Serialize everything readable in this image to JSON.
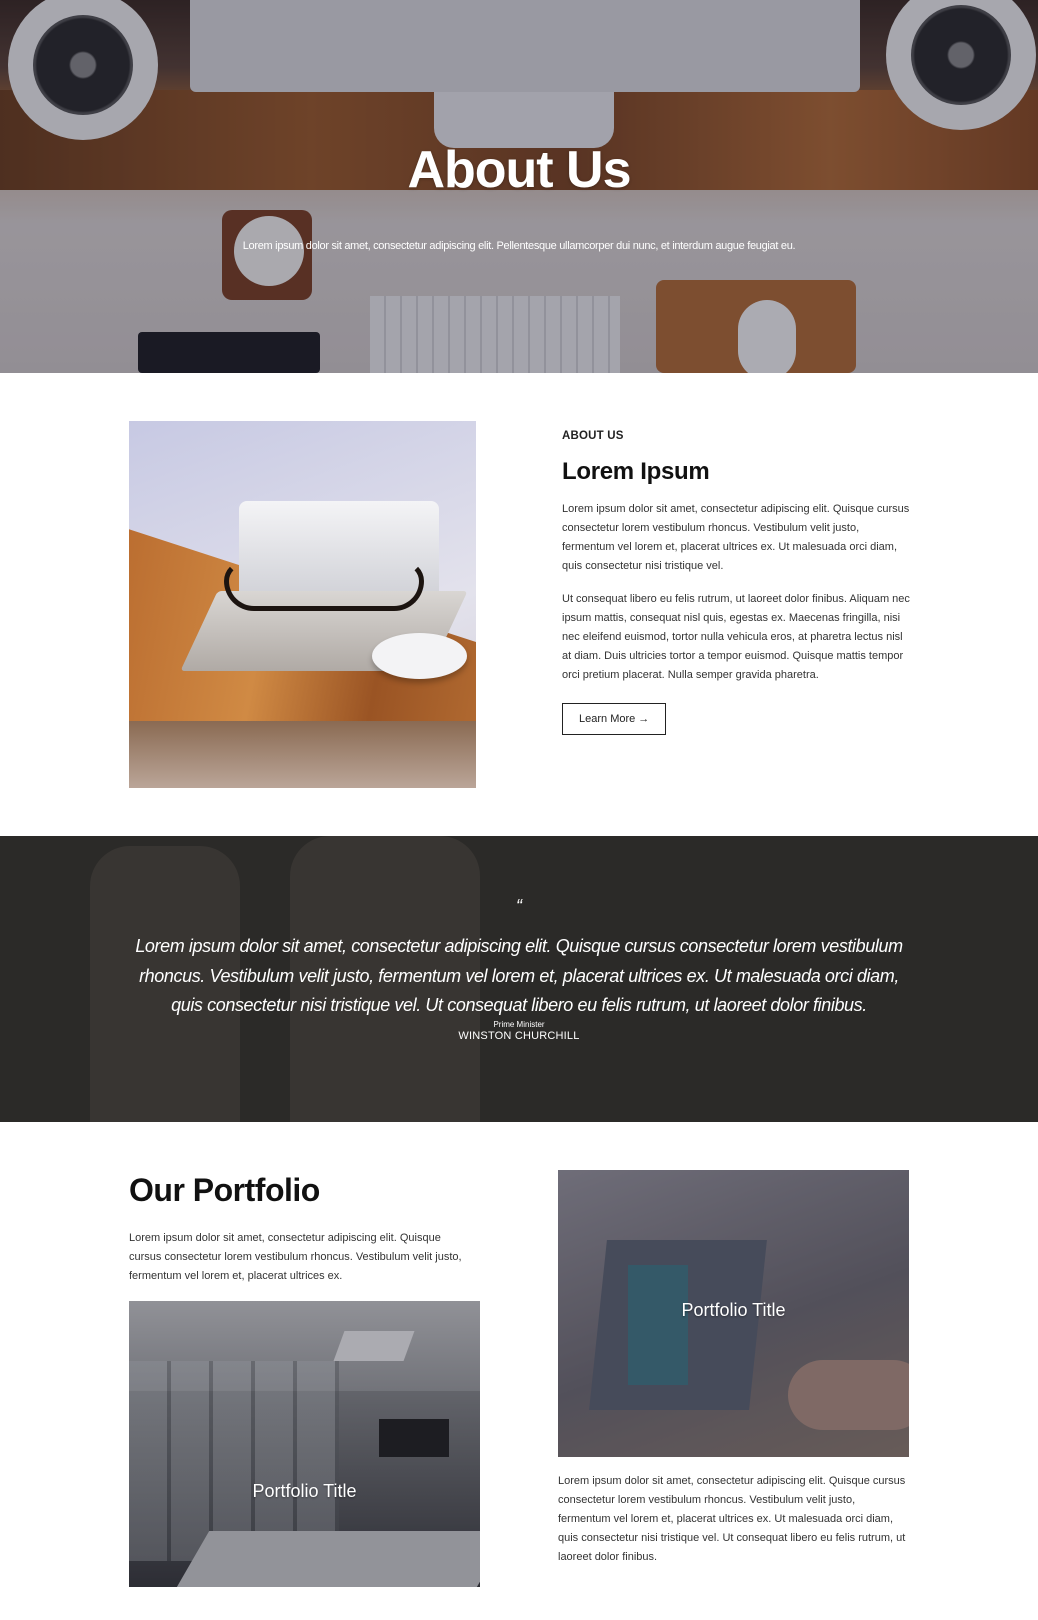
{
  "hero": {
    "title": "About Us",
    "subtitle": "Lorem ipsum dolor sit amet, consectetur adipiscing elit. Pellentesque ullamcorper dui nunc, et interdum augue feugiat eu."
  },
  "about": {
    "eyebrow": "ABOUT US",
    "title": "Lorem Ipsum",
    "paragraph_1": "Lorem ipsum dolor sit amet, consectetur adipiscing elit. Quisque cursus consectetur lorem vestibulum rhoncus. Vestibulum velit justo, fermentum vel lorem et, placerat ultrices ex. Ut malesuada orci diam, quis consectetur nisi tristique vel.",
    "paragraph_2": "Ut consequat libero eu felis rutrum, ut laoreet dolor finibus. Aliquam nec ipsum mattis, consequat nisl quis, egestas ex. Maecenas fringilla, nisi nec eleifend euismod, tortor nulla vehicula eros, at pharetra lectus nisl at diam. Duis ultricies tortor a tempor euismod. Quisque mattis tempor orci pretium placerat. Nulla semper gravida pharetra.",
    "button_label": "Learn More →"
  },
  "quote": {
    "mark": "“",
    "text": "Lorem ipsum dolor sit amet, consectetur adipiscing elit. Quisque cursus consectetur lorem vestibulum rhoncus. Vestibulum velit justo, fermentum vel lorem et, placerat ultrices ex. Ut malesuada orci diam, quis consectetur nisi tristique vel. Ut consequat libero eu felis rutrum, ut laoreet dolor finibus.",
    "role": "Prime Minister",
    "name": "WINSTON CHURCHILL"
  },
  "portfolio": {
    "title": "Our Portfolio",
    "intro": "Lorem ipsum dolor sit amet, consectetur adipiscing elit. Quisque cursus consectetur lorem vestibulum rhoncus. Vestibulum velit justo, fermentum vel lorem et, placerat ultrices ex.",
    "items": [
      {
        "title": "Portfolio Title"
      },
      {
        "title": "Portfolio Title"
      }
    ],
    "description": "Lorem ipsum dolor sit amet, consectetur adipiscing elit. Quisque cursus consectetur lorem vestibulum rhoncus. Vestibulum velit justo, fermentum vel lorem et, placerat ultrices ex. Ut malesuada orci diam, quis consectetur nisi tristique vel. Ut consequat libero eu felis rutrum, ut laoreet dolor finibus."
  },
  "colors": {
    "quote_background": "#2b2a28",
    "text_dark": "#111111",
    "hero_overlay": "#141228"
  }
}
